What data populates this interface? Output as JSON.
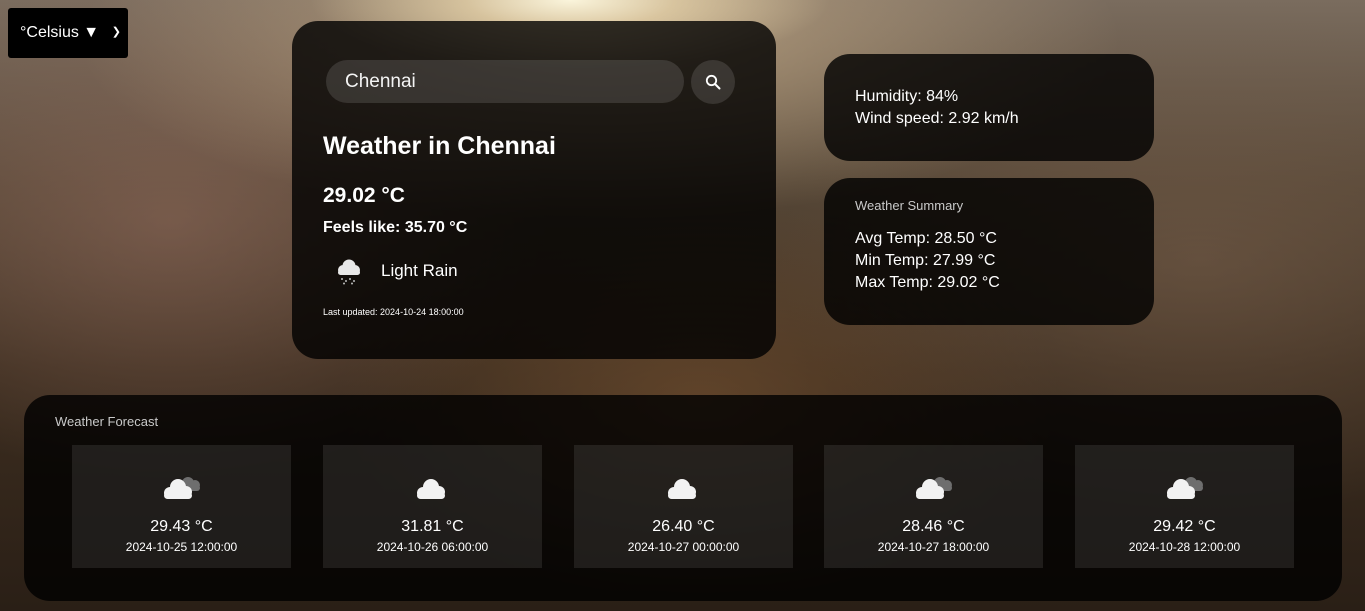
{
  "unit_selector": {
    "value": "°Celsius ▼",
    "options": [
      "°Celsius ▼"
    ]
  },
  "search": {
    "value": "Chennai",
    "icon": "search-icon"
  },
  "current": {
    "title": "Weather in Chennai",
    "temperature": "29.02 °C",
    "feels_like": "Feels like: 35.70 °C",
    "condition": "Light Rain",
    "condition_icon": "cloud-rain-icon",
    "last_updated": "Last updated: 2024-10-24 18:00:00"
  },
  "details": {
    "humidity": "Humidity: 84%",
    "wind": "Wind speed: 2.92 km/h"
  },
  "summary": {
    "title": "Weather Summary",
    "avg": "Avg Temp: 28.50 °C",
    "min": "Min Temp: 27.99 °C",
    "max": "Max Temp: 29.02 °C"
  },
  "forecast": {
    "title": "Weather Forecast",
    "items": [
      {
        "temp": "29.43 °C",
        "date": "2024-10-25 12:00:00",
        "icon": "broken-clouds-icon"
      },
      {
        "temp": "31.81 °C",
        "date": "2024-10-26 06:00:00",
        "icon": "cloud-icon"
      },
      {
        "temp": "26.40 °C",
        "date": "2024-10-27 00:00:00",
        "icon": "cloud-icon"
      },
      {
        "temp": "28.46 °C",
        "date": "2024-10-27 18:00:00",
        "icon": "broken-clouds-icon"
      },
      {
        "temp": "29.42 °C",
        "date": "2024-10-28 12:00:00",
        "icon": "broken-clouds-icon"
      }
    ]
  }
}
